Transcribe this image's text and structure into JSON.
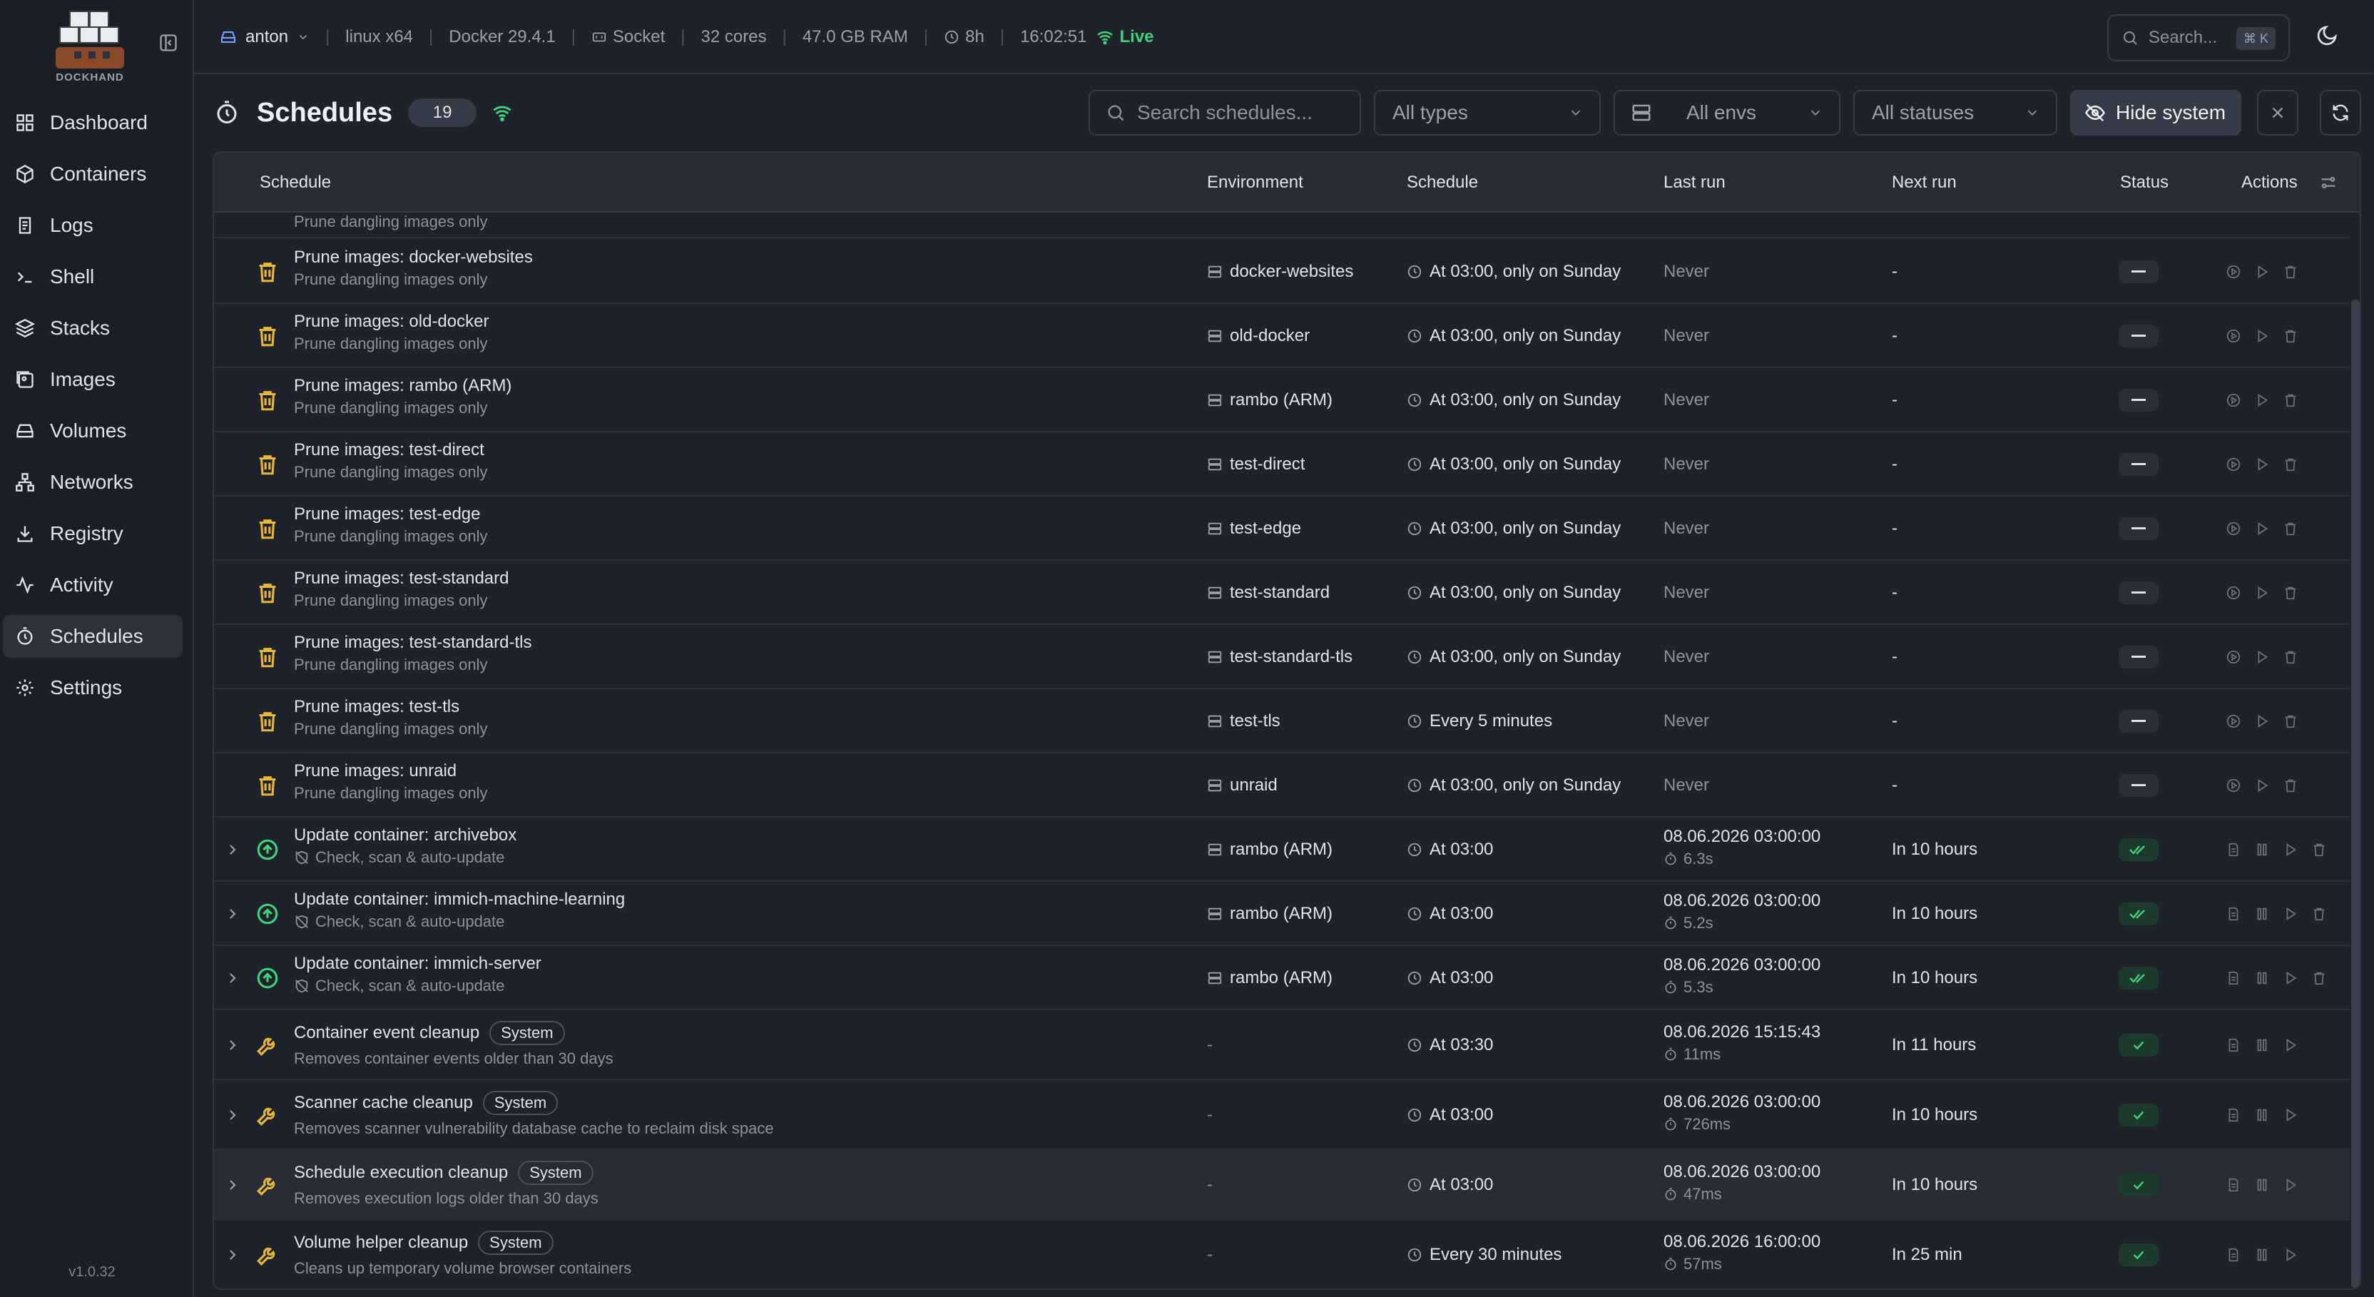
{
  "sidebar": {
    "logo_text": "DOCKHAND",
    "items": [
      {
        "label": "Dashboard",
        "icon": "dashboard-icon"
      },
      {
        "label": "Containers",
        "icon": "box-icon"
      },
      {
        "label": "Logs",
        "icon": "logs-icon"
      },
      {
        "label": "Shell",
        "icon": "terminal-icon"
      },
      {
        "label": "Stacks",
        "icon": "layers-icon"
      },
      {
        "label": "Images",
        "icon": "images-icon"
      },
      {
        "label": "Volumes",
        "icon": "hard-drive-icon"
      },
      {
        "label": "Networks",
        "icon": "network-icon"
      },
      {
        "label": "Registry",
        "icon": "download-icon"
      },
      {
        "label": "Activity",
        "icon": "activity-icon"
      },
      {
        "label": "Schedules",
        "icon": "timer-icon"
      },
      {
        "label": "Settings",
        "icon": "gear-icon"
      }
    ],
    "active": "Schedules",
    "version": "v1.0.32"
  },
  "topbar": {
    "user": "anton",
    "os": "linux x64",
    "docker": "Docker 29.4.1",
    "connection": "Socket",
    "cores": "32 cores",
    "ram": "47.0 GB RAM",
    "uptime": "8h",
    "time": "16:02:51",
    "live": "Live",
    "search_placeholder": "Search...",
    "search_kbd": "⌘ K"
  },
  "page": {
    "title": "Schedules",
    "count": "19",
    "search_placeholder": "Search schedules...",
    "filter_types": "All types",
    "filter_envs": "All envs",
    "filter_statuses": "All statuses",
    "hide_system": "Hide system"
  },
  "table": {
    "headers": {
      "schedule": "Schedule",
      "environment": "Environment",
      "schedule_col": "Schedule",
      "last_run": "Last run",
      "next_run": "Next run",
      "status": "Status",
      "actions": "Actions"
    },
    "partial_row_sub": "Prune dangling images only",
    "rows": [
      {
        "name": "Prune images: docker-websites",
        "sub": "Prune dangling images only",
        "env": "docker-websites",
        "schedule": "At 03:00, only on Sunday",
        "last": "Never",
        "dur": "",
        "next": "-"
      },
      {
        "name": "Prune images: old-docker",
        "sub": "Prune dangling images only",
        "env": "old-docker",
        "schedule": "At 03:00, only on Sunday",
        "last": "Never",
        "dur": "",
        "next": "-"
      },
      {
        "name": "Prune images: rambo (ARM)",
        "sub": "Prune dangling images only",
        "env": "rambo (ARM)",
        "schedule": "At 03:00, only on Sunday",
        "last": "Never",
        "dur": "",
        "next": "-"
      },
      {
        "name": "Prune images: test-direct",
        "sub": "Prune dangling images only",
        "env": "test-direct",
        "schedule": "At 03:00, only on Sunday",
        "last": "Never",
        "dur": "",
        "next": "-"
      },
      {
        "name": "Prune images: test-edge",
        "sub": "Prune dangling images only",
        "env": "test-edge",
        "schedule": "At 03:00, only on Sunday",
        "last": "Never",
        "dur": "",
        "next": "-"
      },
      {
        "name": "Prune images: test-standard",
        "sub": "Prune dangling images only",
        "env": "test-standard",
        "schedule": "At 03:00, only on Sunday",
        "last": "Never",
        "dur": "",
        "next": "-"
      },
      {
        "name": "Prune images: test-standard-tls",
        "sub": "Prune dangling images only",
        "env": "test-standard-tls",
        "schedule": "At 03:00, only on Sunday",
        "last": "Never",
        "dur": "",
        "next": "-"
      },
      {
        "name": "Prune images: test-tls",
        "sub": "Prune dangling images only",
        "env": "test-tls",
        "schedule": "Every 5 minutes",
        "last": "Never",
        "dur": "",
        "next": "-"
      },
      {
        "name": "Prune images: unraid",
        "sub": "Prune dangling images only",
        "env": "unraid",
        "schedule": "At 03:00, only on Sunday",
        "last": "Never",
        "dur": "",
        "next": "-"
      },
      {
        "name": "Update container: archivebox",
        "sub": "Check, scan & auto-update",
        "env": "rambo (ARM)",
        "schedule": "At 03:00",
        "last": "08.06.2026 03:00:00",
        "dur": "6.3s",
        "next": "In 10 hours"
      },
      {
        "name": "Update container: immich-machine-learning",
        "sub": "Check, scan & auto-update",
        "env": "rambo (ARM)",
        "schedule": "At 03:00",
        "last": "08.06.2026 03:00:00",
        "dur": "5.2s",
        "next": "In 10 hours"
      },
      {
        "name": "Update container: immich-server",
        "sub": "Check, scan & auto-update",
        "env": "rambo (ARM)",
        "schedule": "At 03:00",
        "last": "08.06.2026 03:00:00",
        "dur": "5.3s",
        "next": "In 10 hours"
      },
      {
        "name": "Container event cleanup",
        "badge": "System",
        "sub": "Removes container events older than 30 days",
        "env": "-",
        "schedule": "At 03:30",
        "last": "08.06.2026 15:15:43",
        "dur": "11ms",
        "next": "In 11 hours"
      },
      {
        "name": "Scanner cache cleanup",
        "badge": "System",
        "sub": "Removes scanner vulnerability database cache to reclaim disk space",
        "env": "-",
        "schedule": "At 03:00",
        "last": "08.06.2026 03:00:00",
        "dur": "726ms",
        "next": "In 10 hours"
      },
      {
        "name": "Schedule execution cleanup",
        "badge": "System",
        "sub": "Removes execution logs older than 30 days",
        "env": "-",
        "schedule": "At 03:00",
        "last": "08.06.2026 03:00:00",
        "dur": "47ms",
        "next": "In 10 hours"
      },
      {
        "name": "Volume helper cleanup",
        "badge": "System",
        "sub": "Cleans up temporary volume browser containers",
        "env": "-",
        "schedule": "Every 30 minutes",
        "last": "08.06.2026 16:00:00",
        "dur": "57ms",
        "next": "In 25 min"
      }
    ]
  },
  "colors": {
    "accent_green": "#3fd27a",
    "prune_yellow": "#e8b73a",
    "bg": "#1e222a"
  }
}
